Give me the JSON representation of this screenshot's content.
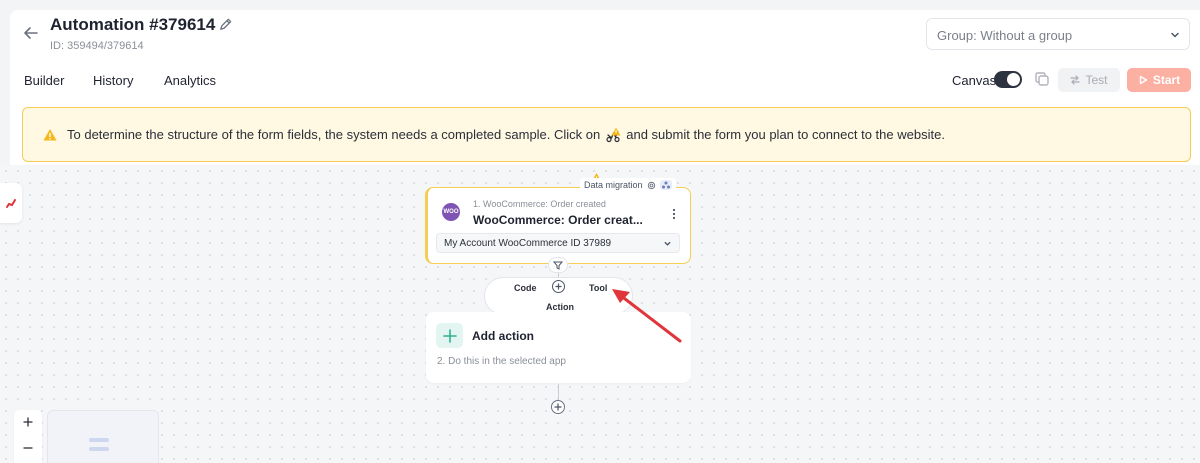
{
  "header": {
    "title": "Automation #379614",
    "id_label": "ID: 359494/379614",
    "group_select": "Group: Without a group"
  },
  "tabs": [
    {
      "label": "Builder"
    },
    {
      "label": "History"
    },
    {
      "label": "Analytics"
    }
  ],
  "toolbar": {
    "canvas_label": "Canvas",
    "canvas_toggle_on": true,
    "test_label": "Test",
    "start_label": "Start"
  },
  "warning": {
    "text_before": "To determine the structure of the form fields, the system needs a completed sample. Click on",
    "text_after": "and submit the form you plan to connect to the website."
  },
  "trigger_node": {
    "badge": "Data migration",
    "logo_text": "WOO",
    "step": "1. WooCommerce: Order created",
    "title": "WooCommerce: Order creat...",
    "account": "My Account WooCommerce ID 37989"
  },
  "popover": {
    "code": "Code",
    "tool": "Tool",
    "action": "Action"
  },
  "add_action": {
    "title": "Add action",
    "subtitle": "2. Do this in the selected app"
  },
  "colors": {
    "accent_start": "#fcb0a2",
    "warning_border": "#f5cc54",
    "warning_bg": "#fff8e3",
    "woo_purple": "#7f54b3",
    "arrow_red": "#e0353a"
  },
  "icons": [
    "back-arrow-icon",
    "pencil-icon",
    "chevron-down-icon",
    "copy-icon",
    "shuffle-icon",
    "play-icon",
    "warning-icon",
    "pointer-icon",
    "filter-icon",
    "plus-icon",
    "gear-icon",
    "kebab-icon"
  ]
}
